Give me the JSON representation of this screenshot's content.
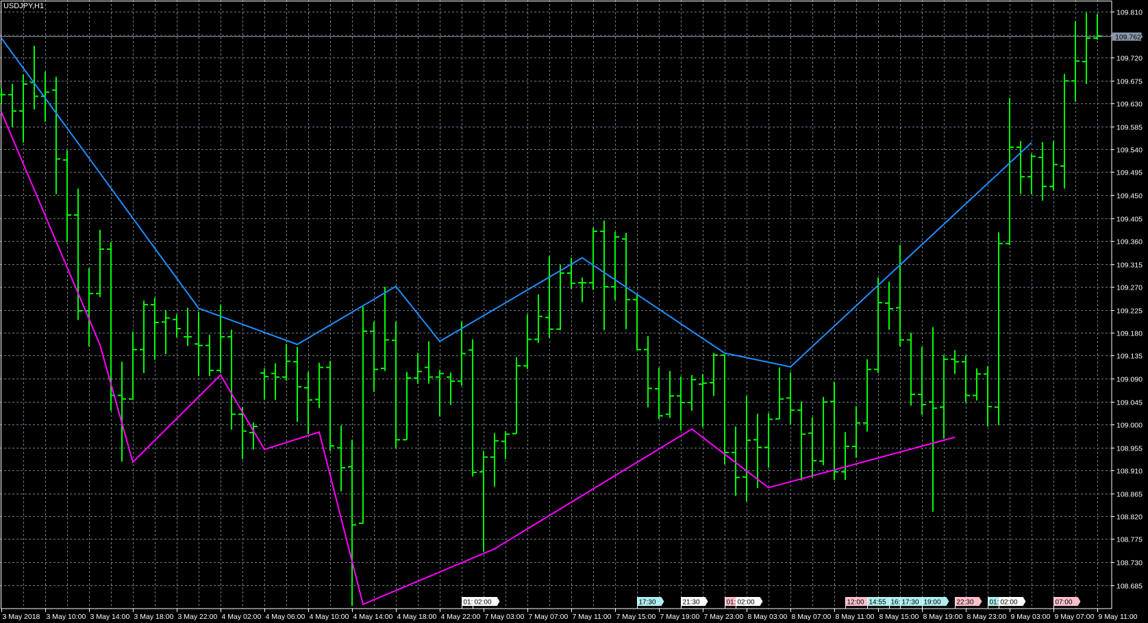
{
  "window": {
    "title": "USDJPY,H1"
  },
  "colors": {
    "background": "#000000",
    "bars": "#00ff00",
    "grid": "#6f7f8f",
    "axis": "#ffffff",
    "upper_line": "#1e90ff",
    "lower_line": "#ff00ff",
    "bid_line": "#8a98a8",
    "event_pink": "#ffc0cb",
    "event_cyan": "#afeeee",
    "event_white": "#ffffff"
  },
  "chart_data": {
    "type": "ohlc-bar",
    "symbol": "USDJPY",
    "timeframe": "H1",
    "ylim": [
      108.66,
      109.82
    ],
    "grid": true,
    "current_price": "109.762",
    "y_ticks": [
      "109.810",
      "109.765",
      "109.720",
      "109.675",
      "109.630",
      "109.585",
      "109.540",
      "109.495",
      "109.450",
      "109.405",
      "109.360",
      "109.315",
      "109.270",
      "109.225",
      "109.180",
      "109.135",
      "109.090",
      "109.045",
      "109.000",
      "108.955",
      "108.910",
      "108.865",
      "108.820",
      "108.775",
      "108.730",
      "108.685"
    ],
    "x_ticks": [
      "3 May 2018",
      "3 May 10:00",
      "3 May 14:00",
      "3 May 18:00",
      "3 May 22:00",
      "4 May 02:00",
      "4 May 06:00",
      "4 May 10:00",
      "4 May 14:00",
      "4 May 18:00",
      "4 May 22:00",
      "7 May 03:00",
      "7 May 07:00",
      "7 May 11:00",
      "7 May 15:00",
      "7 May 19:00",
      "7 May 23:00",
      "8 May 03:00",
      "8 May 07:00",
      "8 May 11:00",
      "8 May 15:00",
      "8 May 19:00",
      "8 May 23:00",
      "9 May 03:00",
      "9 May 07:00",
      "9 May 11:00"
    ],
    "x_tick_every_bars": 4,
    "ohlc": [
      [
        109.647,
        109.66,
        109.63,
        109.647
      ],
      [
        109.647,
        109.668,
        109.583,
        109.615
      ],
      [
        109.615,
        109.687,
        109.553,
        109.668
      ],
      [
        109.671,
        109.743,
        109.618,
        109.644
      ],
      [
        109.644,
        109.692,
        109.594,
        109.652
      ],
      [
        109.656,
        109.682,
        109.452,
        109.521
      ],
      [
        109.519,
        109.538,
        109.358,
        109.411
      ],
      [
        109.411,
        109.463,
        109.205,
        109.223
      ],
      [
        109.223,
        109.307,
        109.153,
        109.257
      ],
      [
        109.257,
        109.382,
        109.25,
        109.344
      ],
      [
        109.344,
        109.358,
        109.027,
        109.057
      ],
      [
        109.057,
        109.123,
        108.927,
        109.05
      ],
      [
        109.05,
        109.182,
        109.05,
        109.147
      ],
      [
        109.147,
        109.243,
        109.101,
        109.235
      ],
      [
        109.235,
        109.249,
        109.127,
        109.2
      ],
      [
        109.201,
        109.224,
        109.138,
        109.209
      ],
      [
        109.206,
        109.216,
        109.171,
        109.188
      ],
      [
        109.172,
        109.229,
        109.154,
        109.172
      ],
      [
        109.158,
        109.221,
        109.095,
        109.155
      ],
      [
        109.155,
        109.176,
        109.095,
        109.106
      ],
      [
        109.106,
        109.235,
        109.101,
        109.172
      ],
      [
        109.172,
        109.186,
        108.99,
        109.02
      ],
      [
        109.02,
        109.034,
        108.932,
        108.987
      ],
      [
        108.984,
        109.004,
        108.951,
        108.996
      ],
      [
        109.101,
        109.11,
        109.049,
        109.094
      ],
      [
        109.1,
        109.12,
        109.048,
        109.093
      ],
      [
        109.093,
        109.158,
        109.086,
        109.124
      ],
      [
        109.123,
        109.152,
        109.005,
        109.074
      ],
      [
        109.072,
        109.103,
        108.981,
        109.048
      ],
      [
        109.049,
        109.121,
        109.032,
        109.112
      ],
      [
        109.112,
        109.125,
        108.948,
        108.958
      ],
      [
        108.954,
        108.998,
        108.869,
        108.915
      ],
      [
        108.917,
        108.97,
        108.644,
        108.803
      ],
      [
        108.806,
        109.231,
        108.806,
        109.183
      ],
      [
        109.183,
        109.202,
        109.064,
        109.108
      ],
      [
        109.11,
        109.27,
        109.105,
        109.166
      ],
      [
        109.165,
        109.202,
        108.954,
        108.97
      ],
      [
        108.97,
        109.103,
        108.97,
        109.091
      ],
      [
        109.091,
        109.14,
        109.08,
        109.104
      ],
      [
        109.112,
        109.163,
        109.08,
        109.093
      ],
      [
        109.093,
        109.107,
        109.016,
        109.1
      ],
      [
        109.093,
        109.102,
        109.038,
        109.085
      ],
      [
        109.085,
        109.202,
        109.076,
        109.139
      ],
      [
        109.146,
        109.167,
        108.898,
        108.906
      ],
      [
        108.907,
        108.948,
        108.751,
        108.936
      ],
      [
        108.936,
        108.983,
        108.878,
        108.968
      ],
      [
        108.967,
        108.987,
        108.932,
        108.981
      ],
      [
        108.982,
        109.132,
        108.982,
        109.115
      ],
      [
        109.115,
        109.216,
        109.109,
        109.167
      ],
      [
        109.167,
        109.255,
        109.16,
        109.212
      ],
      [
        109.21,
        109.33,
        109.17,
        109.187
      ],
      [
        109.187,
        109.313,
        109.185,
        109.297
      ],
      [
        109.297,
        109.327,
        109.266,
        109.277
      ],
      [
        109.278,
        109.288,
        109.24,
        109.278
      ],
      [
        109.278,
        109.386,
        109.264,
        109.379
      ],
      [
        109.379,
        109.4,
        109.185,
        109.27
      ],
      [
        109.27,
        109.378,
        109.244,
        109.368
      ],
      [
        109.364,
        109.376,
        109.187,
        109.245
      ],
      [
        109.245,
        109.257,
        109.146,
        109.147
      ],
      [
        109.147,
        109.173,
        109.034,
        109.071
      ],
      [
        109.07,
        109.111,
        109.011,
        109.017
      ],
      [
        109.02,
        109.105,
        109.013,
        109.056
      ],
      [
        109.056,
        109.094,
        108.988,
        109.043
      ],
      [
        109.043,
        109.097,
        109.027,
        109.088
      ],
      [
        109.079,
        109.099,
        108.995,
        109.081
      ],
      [
        109.082,
        109.14,
        109.056,
        109.136
      ],
      [
        109.136,
        109.137,
        108.922,
        108.945
      ],
      [
        108.945,
        108.996,
        108.86,
        108.896
      ],
      [
        108.897,
        109.056,
        108.849,
        108.969
      ],
      [
        108.97,
        109.021,
        108.875,
        108.955
      ],
      [
        108.955,
        109.022,
        108.915,
        109.01
      ],
      [
        109.011,
        109.112,
        109.011,
        109.05
      ],
      [
        109.052,
        109.102,
        109.001,
        109.028
      ],
      [
        109.028,
        109.045,
        108.89,
        108.981
      ],
      [
        108.983,
        109.014,
        108.896,
        108.929
      ],
      [
        108.928,
        109.054,
        108.92,
        109.044
      ],
      [
        109.045,
        109.084,
        108.891,
        108.907
      ],
      [
        108.907,
        108.985,
        108.891,
        108.957
      ],
      [
        108.957,
        109.036,
        108.935,
        109.003
      ],
      [
        109.003,
        109.128,
        108.986,
        109.108
      ],
      [
        109.108,
        109.288,
        109.101,
        109.239
      ],
      [
        109.238,
        109.28,
        109.186,
        109.227
      ],
      [
        109.229,
        109.352,
        109.153,
        109.166
      ],
      [
        109.166,
        109.18,
        109.037,
        109.059
      ],
      [
        109.059,
        109.152,
        109.019,
        109.039
      ],
      [
        109.044,
        109.191,
        108.829,
        109.032
      ],
      [
        109.034,
        109.136,
        108.972,
        109.128
      ],
      [
        109.128,
        109.146,
        109.099,
        109.123
      ],
      [
        109.123,
        109.136,
        109.043,
        109.057
      ],
      [
        109.057,
        109.11,
        109.047,
        109.099
      ],
      [
        109.099,
        109.114,
        108.996,
        109.035
      ],
      [
        109.034,
        109.377,
        108.999,
        109.355
      ],
      [
        109.355,
        109.641,
        109.352,
        109.544
      ],
      [
        109.544,
        109.556,
        109.452,
        109.486
      ],
      [
        109.486,
        109.531,
        109.452,
        109.526
      ],
      [
        109.524,
        109.554,
        109.439,
        109.467
      ],
      [
        109.467,
        109.556,
        109.459,
        109.51
      ],
      [
        109.507,
        109.688,
        109.463,
        109.674
      ],
      [
        109.674,
        109.791,
        109.633,
        109.713
      ],
      [
        109.712,
        109.808,
        109.668,
        109.758
      ],
      [
        109.758,
        109.805,
        109.755,
        109.762
      ]
    ],
    "upper_line": [
      [
        0,
        109.758
      ],
      [
        18,
        109.228
      ],
      [
        27,
        109.157
      ],
      [
        36,
        109.271
      ],
      [
        40,
        109.163
      ],
      [
        53,
        109.327
      ],
      [
        66,
        109.14
      ],
      [
        72,
        109.113
      ],
      [
        94,
        109.553
      ]
    ],
    "lower_line": [
      [
        0,
        109.613
      ],
      [
        9,
        109.156
      ],
      [
        12,
        108.926
      ],
      [
        20,
        109.097
      ],
      [
        24,
        108.951
      ],
      [
        29,
        108.985
      ],
      [
        33,
        108.647
      ],
      [
        45,
        108.756
      ],
      [
        63,
        108.991
      ],
      [
        70,
        108.876
      ],
      [
        87,
        108.975
      ]
    ],
    "events": [
      {
        "bar": 42,
        "label": "01:",
        "color": "white"
      },
      {
        "bar": 43,
        "label": "02:00",
        "color": "white"
      },
      {
        "bar": 58,
        "label": "17:30",
        "color": "cyan"
      },
      {
        "bar": 62,
        "label": "21:30",
        "color": "white"
      },
      {
        "bar": 66,
        "label": "01:",
        "color": "pink"
      },
      {
        "bar": 67,
        "label": "02:00",
        "color": "white"
      },
      {
        "bar": 77,
        "label": "12:00",
        "color": "pink"
      },
      {
        "bar": 79,
        "label": "14:55",
        "color": "cyan"
      },
      {
        "bar": 81,
        "label": "16:",
        "color": "cyan"
      },
      {
        "bar": 82,
        "label": "17:30",
        "color": "cyan"
      },
      {
        "bar": 84,
        "label": "19:00",
        "color": "cyan"
      },
      {
        "bar": 87,
        "label": "22:30",
        "color": "pink"
      },
      {
        "bar": 90,
        "label": "01:",
        "color": "cyan"
      },
      {
        "bar": 91,
        "label": "02:00",
        "color": "white"
      },
      {
        "bar": 96,
        "label": "07:00",
        "color": "pink"
      }
    ]
  }
}
